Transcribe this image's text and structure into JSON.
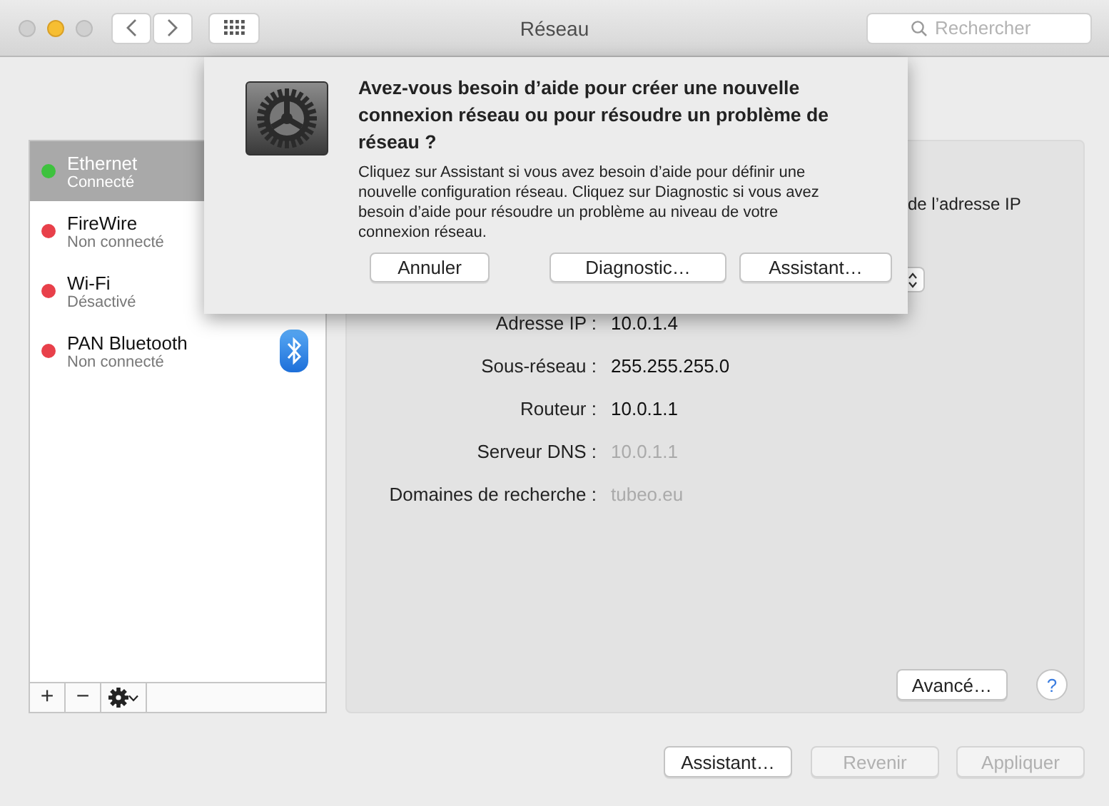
{
  "window": {
    "title": "Réseau",
    "controls": [
      {
        "kind": "close",
        "enabled": false
      },
      {
        "kind": "minimize",
        "enabled": true
      },
      {
        "kind": "zoom",
        "enabled": false
      }
    ]
  },
  "toolbar": {
    "search": {
      "placeholder": "Rechercher"
    }
  },
  "sidebar": {
    "items": [
      {
        "name": "Ethernet",
        "status": "Connecté",
        "color": "#3ec23e",
        "selected": true,
        "kind": "plain"
      },
      {
        "name": "FireWire",
        "status": "Non connecté",
        "color": "#e8404a",
        "selected": false,
        "kind": "plain"
      },
      {
        "name": "Wi-Fi",
        "status": "Désactivé",
        "color": "#e8404a",
        "selected": false,
        "kind": "plain"
      },
      {
        "name": "PAN Bluetooth",
        "status": "Non connecté",
        "color": "#e8404a",
        "selected": false,
        "kind": "bluetooth"
      }
    ],
    "add_button": "+",
    "remove_button": "−"
  },
  "panel": {
    "partial_text": "de l’adresse IP",
    "fields": [
      {
        "label": "Adresse IP :",
        "value": "10.0.1.4",
        "dimmed": false
      },
      {
        "label": "Sous-réseau :",
        "value": "255.255.255.0",
        "dimmed": false
      },
      {
        "label": "Routeur :",
        "value": "10.0.1.1",
        "dimmed": false
      },
      {
        "label": "Serveur DNS :",
        "value": "10.0.1.1",
        "dimmed": true
      },
      {
        "label": "Domaines de recherche :",
        "value": "tubeo.eu",
        "dimmed": true
      }
    ],
    "advanced_button": "Avancé…",
    "help_button": "?"
  },
  "footer": {
    "buttons": [
      {
        "label": "Assistant…",
        "disabled": false
      },
      {
        "label": "Revenir",
        "disabled": true
      },
      {
        "label": "Appliquer",
        "disabled": true
      }
    ]
  },
  "dialog": {
    "title": "Avez-vous besoin d’aide pour créer une nouvelle connexion réseau ou pour résoudre un problème de réseau ?",
    "message": "Cliquez sur Assistant si vous avez besoin d’aide pour définir une nouvelle configuration réseau. Cliquez sur Diagnostic si vous avez besoin d’aide pour résoudre un problème au niveau de votre connexion réseau.",
    "buttons": [
      "Annuler",
      "Diagnostic…",
      "Assistant…"
    ]
  }
}
